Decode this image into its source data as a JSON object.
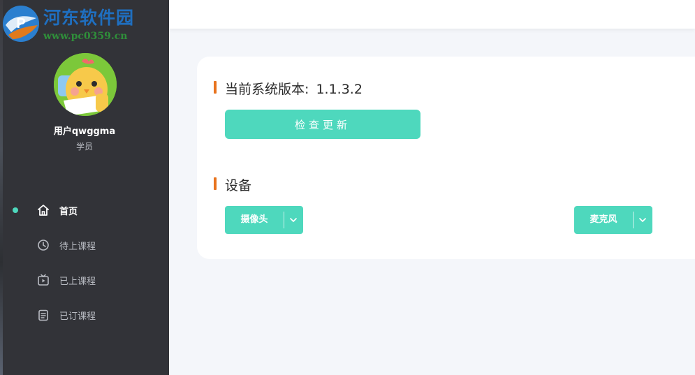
{
  "watermark": {
    "title": "河东软件园",
    "url": "www.pc0359.cn"
  },
  "user": {
    "name": "用户qwggma",
    "role": "学员"
  },
  "nav": {
    "items": [
      {
        "label": "首页",
        "icon": "home-icon",
        "active": true
      },
      {
        "label": "待上课程",
        "icon": "clock-icon",
        "active": false
      },
      {
        "label": "已上课程",
        "icon": "tv-play-icon",
        "active": false
      },
      {
        "label": "已订课程",
        "icon": "clipboard-icon",
        "active": false
      }
    ]
  },
  "version": {
    "label": "当前系统版本:",
    "value": "1.1.3.2",
    "check_button": "检查更新"
  },
  "devices": {
    "title": "设备",
    "camera_label": "摄像头",
    "mic_label": "麦克风"
  },
  "colors": {
    "accent": "#4ed8bd",
    "section_marker": "#e8731e",
    "sidebar_bg": "#323338",
    "page_bg": "#f4f6fa"
  }
}
